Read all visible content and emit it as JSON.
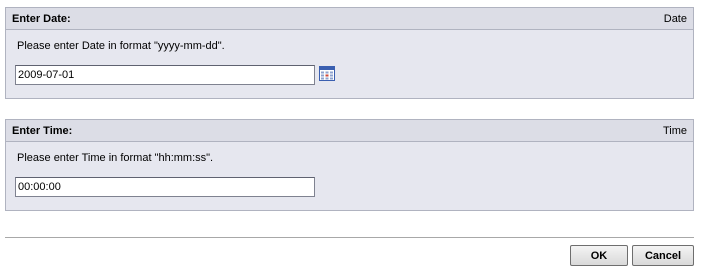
{
  "date_panel": {
    "title": "Enter Date:",
    "type_label": "Date",
    "hint": "Please enter Date in format \"yyyy-mm-dd\".",
    "value": "2009-07-01"
  },
  "time_panel": {
    "title": "Enter Time:",
    "type_label": "Time",
    "hint": "Please enter Time in format \"hh:mm:ss\".",
    "value": "00:00:00"
  },
  "icons": {
    "calendar": "calendar-icon"
  },
  "buttons": {
    "ok_label": "OK",
    "cancel_label": "Cancel"
  },
  "colors": {
    "panel_bg": "#e6e7ef",
    "panel_border": "#b0b3c0",
    "calendar_blue": "#3a5fb0"
  }
}
